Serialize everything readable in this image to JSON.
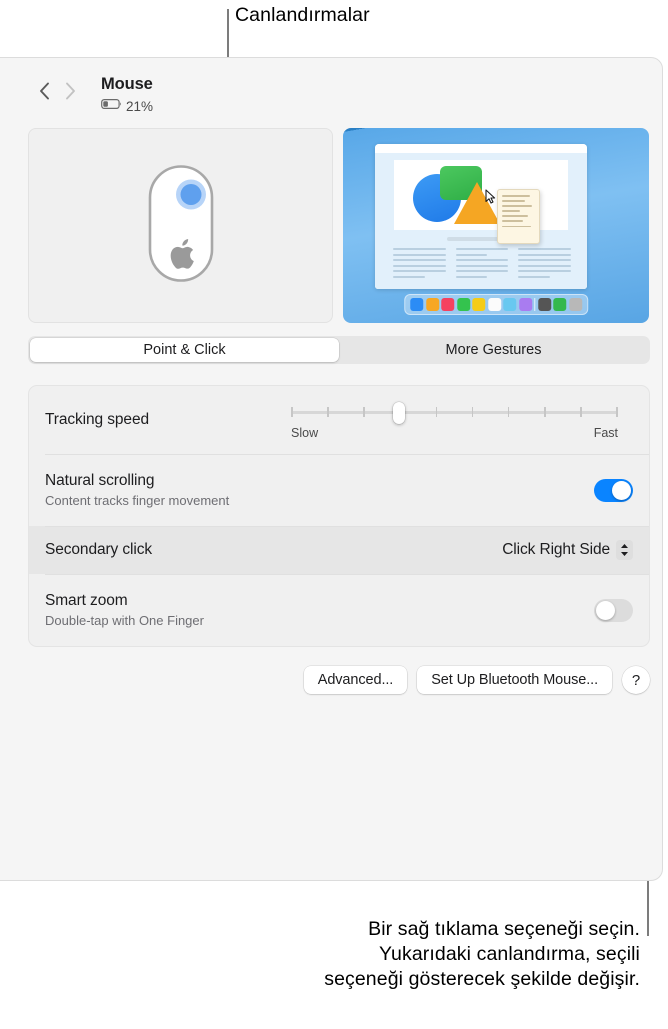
{
  "annotations": {
    "top": "Canlandırmalar",
    "bottom": "Bir sağ tıklama seçeneği seçin.\nYukarıdaki canlandırma, seçili\nseçeneği gösterecek şekilde değişir."
  },
  "header": {
    "back_icon": "chevron-left-icon",
    "forward_icon": "chevron-right-icon",
    "title": "Mouse",
    "battery_icon": "battery-low-icon",
    "battery_percent": "21%"
  },
  "preview": {
    "mouse_illustration": "magic-mouse-right-click-illustration",
    "animation_panel": "secondary-click-animation"
  },
  "tabs": [
    {
      "label": "Point & Click",
      "selected": true
    },
    {
      "label": "More Gestures",
      "selected": false
    }
  ],
  "settings": {
    "tracking": {
      "label": "Tracking speed",
      "slow_label": "Slow",
      "fast_label": "Fast",
      "tick_count": 10,
      "value_percent": 33
    },
    "natural_scrolling": {
      "label": "Natural scrolling",
      "sublabel": "Content tracks finger movement",
      "state": "on"
    },
    "secondary_click": {
      "label": "Secondary click",
      "value": "Click Right Side",
      "chevron_icon": "chevron-up-down-icon",
      "highlighted": true
    },
    "smart_zoom": {
      "label": "Smart zoom",
      "sublabel": "Double-tap with One Finger",
      "state": "off"
    }
  },
  "buttons": {
    "advanced": "Advanced...",
    "setup_bluetooth": "Set Up Bluetooth Mouse...",
    "help": "?"
  },
  "colors": {
    "accent_blue": "#0a84ff",
    "panel_bg": "#f5f5f5",
    "group_bg": "#f0f0f0",
    "row_highlight": "#e6e6e6",
    "anim_blue": "#59a8e8"
  },
  "dock_icons": [
    "#2b8cf5",
    "#f7a723",
    "#f5415f",
    "#34c34e",
    "#f5cc17",
    "#fbfbfb",
    "#68c8f0",
    "#a97cf0",
    "separator",
    "#555555",
    "#34b84e",
    "#b8b8b8"
  ]
}
